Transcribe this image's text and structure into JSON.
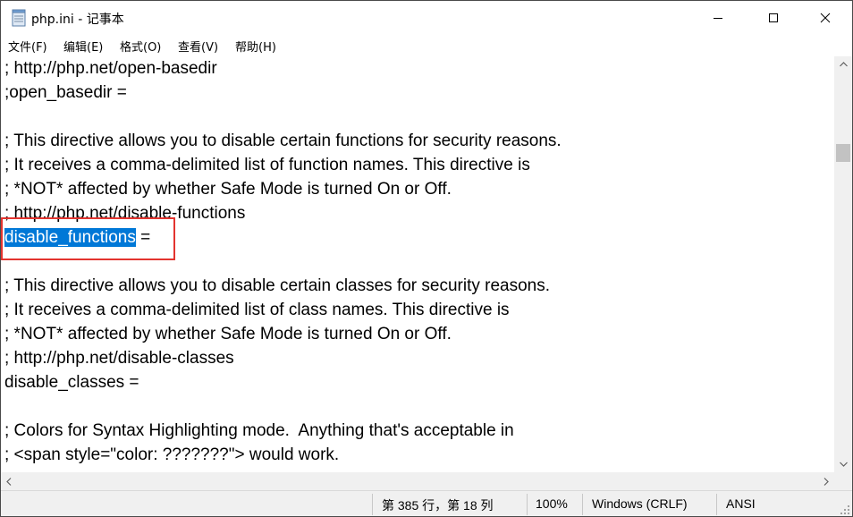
{
  "window": {
    "title": "php.ini - 记事本",
    "icon": "notepad-icon"
  },
  "menu": [
    "文件(F)",
    "编辑(E)",
    "格式(O)",
    "查看(V)",
    "帮助(H)"
  ],
  "editor": {
    "lines": [
      "; http://php.net/open-basedir",
      ";open_basedir =",
      "",
      "; This directive allows you to disable certain functions for security reasons.",
      "; It receives a comma-delimited list of function names. This directive is",
      "; *NOT* affected by whether Safe Mode is turned On or Off.",
      "; http://php.net/disable-functions",
      "",
      "",
      "; This directive allows you to disable certain classes for security reasons.",
      "; It receives a comma-delimited list of class names. This directive is",
      "; *NOT* affected by whether Safe Mode is turned On or Off.",
      "; http://php.net/disable-classes",
      "disable_classes =",
      "",
      "; Colors for Syntax Highlighting mode.  Anything that's acceptable in",
      "; <span style=\"color: ???????\"> would work."
    ],
    "selected_text": "disable_functions",
    "after_selection": " =",
    "selection_color": "#0078d7",
    "annotation_box_color": "#e3342f"
  },
  "status": {
    "position": "第 385 行，第 18 列",
    "zoom": "100%",
    "line_ending": "Windows (CRLF)",
    "encoding": "ANSI"
  }
}
